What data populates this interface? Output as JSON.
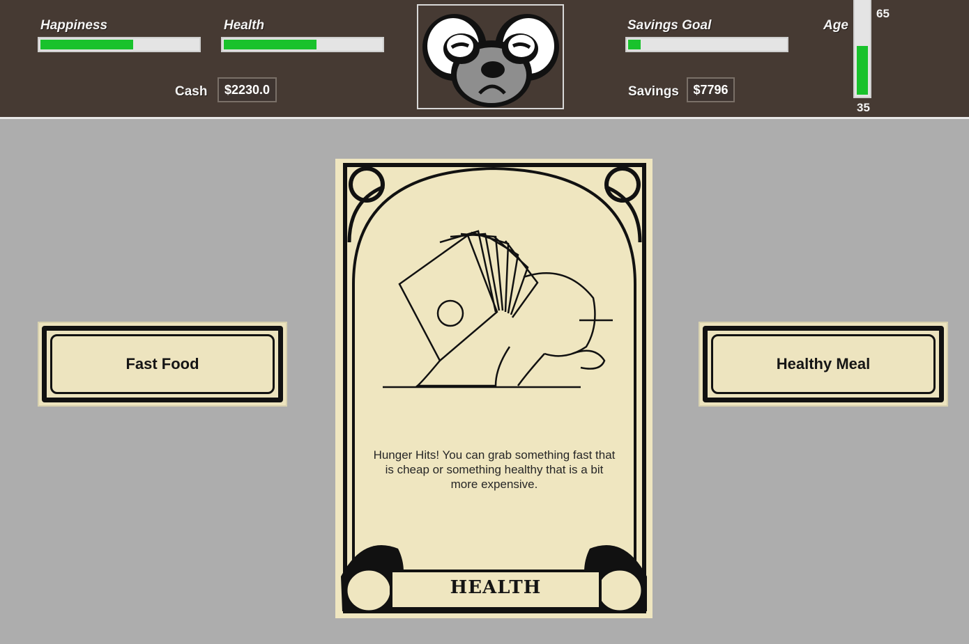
{
  "hud": {
    "happiness": {
      "label": "Happiness",
      "level": 0.59
    },
    "health": {
      "label": "Health",
      "level": 0.59
    },
    "savings_goal": {
      "label": "Savings Goal",
      "level": 0.08
    },
    "age": {
      "label": "Age",
      "max_label": "65",
      "min_label": "35",
      "level": 0.53
    },
    "cash": {
      "label": "Cash",
      "value": "$2230.0"
    },
    "savings": {
      "label": "Savings",
      "value": "$7796"
    },
    "avatar_mood": "sad"
  },
  "choices": {
    "left": "Fast Food",
    "right": "Healthy Meal"
  },
  "card": {
    "text": "Hunger Hits! You can grab something fast that is cheap or something healthy that is a bit more expensive.",
    "category": "HEALTH"
  },
  "colors": {
    "hud_bg": "#463a33",
    "bar_fill": "#19c22c",
    "card_bg": "#efe6c0",
    "page_bg": "#adadad"
  }
}
